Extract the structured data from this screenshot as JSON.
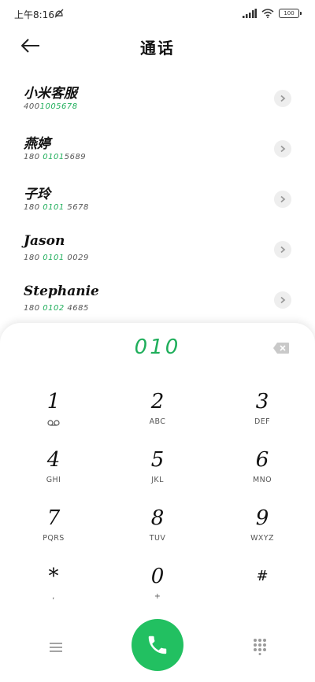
{
  "status_bar": {
    "time": "上午8:16",
    "battery": "100"
  },
  "header": {
    "title": "通话"
  },
  "contacts": [
    {
      "name": "小米客服",
      "number_parts": [
        "400",
        "1005678",
        ""
      ],
      "highlight_index": 1
    },
    {
      "name": "燕婷",
      "number_parts": [
        "180 ",
        "0101",
        "5689"
      ]
    },
    {
      "name": "子玲",
      "number_parts": [
        "180 ",
        "0101",
        " 5678"
      ]
    },
    {
      "name": "Jason",
      "number_parts": [
        "180 ",
        "0101",
        " 0029"
      ]
    },
    {
      "name": "Stephanie",
      "number_parts": [
        "180 ",
        "0102",
        " 4685"
      ]
    }
  ],
  "dialer": {
    "input": "010",
    "keys": [
      {
        "digit": "1",
        "letters": ""
      },
      {
        "digit": "2",
        "letters": "ABC"
      },
      {
        "digit": "3",
        "letters": "DEF"
      },
      {
        "digit": "4",
        "letters": "GHI"
      },
      {
        "digit": "5",
        "letters": "JKL"
      },
      {
        "digit": "6",
        "letters": "MNO"
      },
      {
        "digit": "7",
        "letters": "PQRS"
      },
      {
        "digit": "8",
        "letters": "TUV"
      },
      {
        "digit": "9",
        "letters": "WXYZ"
      },
      {
        "digit": "*",
        "letters": ","
      },
      {
        "digit": "0",
        "letters": "+"
      },
      {
        "digit": "#",
        "letters": ""
      }
    ]
  },
  "colors": {
    "accent": "#1fae5b",
    "call_button": "#22c061"
  },
  "icons": {
    "back": "arrow-left-icon",
    "detail": "chevron-right-icon",
    "backspace": "backspace-icon",
    "voicemail": "voicemail-icon",
    "menu": "menu-icon",
    "call": "phone-icon",
    "keypad": "dialpad-icon"
  }
}
